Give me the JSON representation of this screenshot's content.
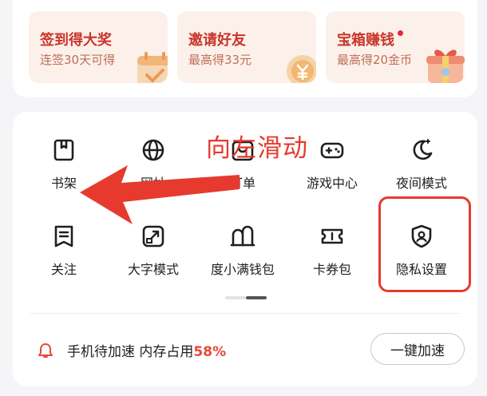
{
  "promos": [
    {
      "title": "签到得大奖",
      "subtitle": "连签30天可得",
      "icon": "calendar-icon",
      "dot": false
    },
    {
      "title": "邀请好友",
      "subtitle": "最高得33元",
      "icon": "coin-icon",
      "dot": false
    },
    {
      "title": "宝箱赚钱",
      "subtitle": "最高得20金币",
      "icon": "gift-box-icon",
      "dot": true
    }
  ],
  "grid": [
    {
      "label": "书架",
      "icon": "bookshelf-icon"
    },
    {
      "label": "网址",
      "icon": "globe-icon"
    },
    {
      "label": "订单",
      "icon": "order-icon"
    },
    {
      "label": "游戏中心",
      "icon": "gamepad-icon"
    },
    {
      "label": "夜间模式",
      "icon": "moon-icon"
    },
    {
      "label": "关注",
      "icon": "bookmark-icon"
    },
    {
      "label": "大字模式",
      "icon": "expand-icon"
    },
    {
      "label": "度小满钱包",
      "icon": "wallet-icon"
    },
    {
      "label": "卡券包",
      "icon": "ticket-icon"
    },
    {
      "label": "隐私设置",
      "icon": "shield-user-icon"
    }
  ],
  "status": {
    "text": "手机待加速 内存占用",
    "percent": "58%"
  },
  "boost_button": "一键加速",
  "annotation": {
    "text": "向左滑动"
  },
  "colors": {
    "accent_red": "#e63a2e",
    "promo_bg": "#fbf1ea",
    "promo_title": "#c9352b"
  }
}
